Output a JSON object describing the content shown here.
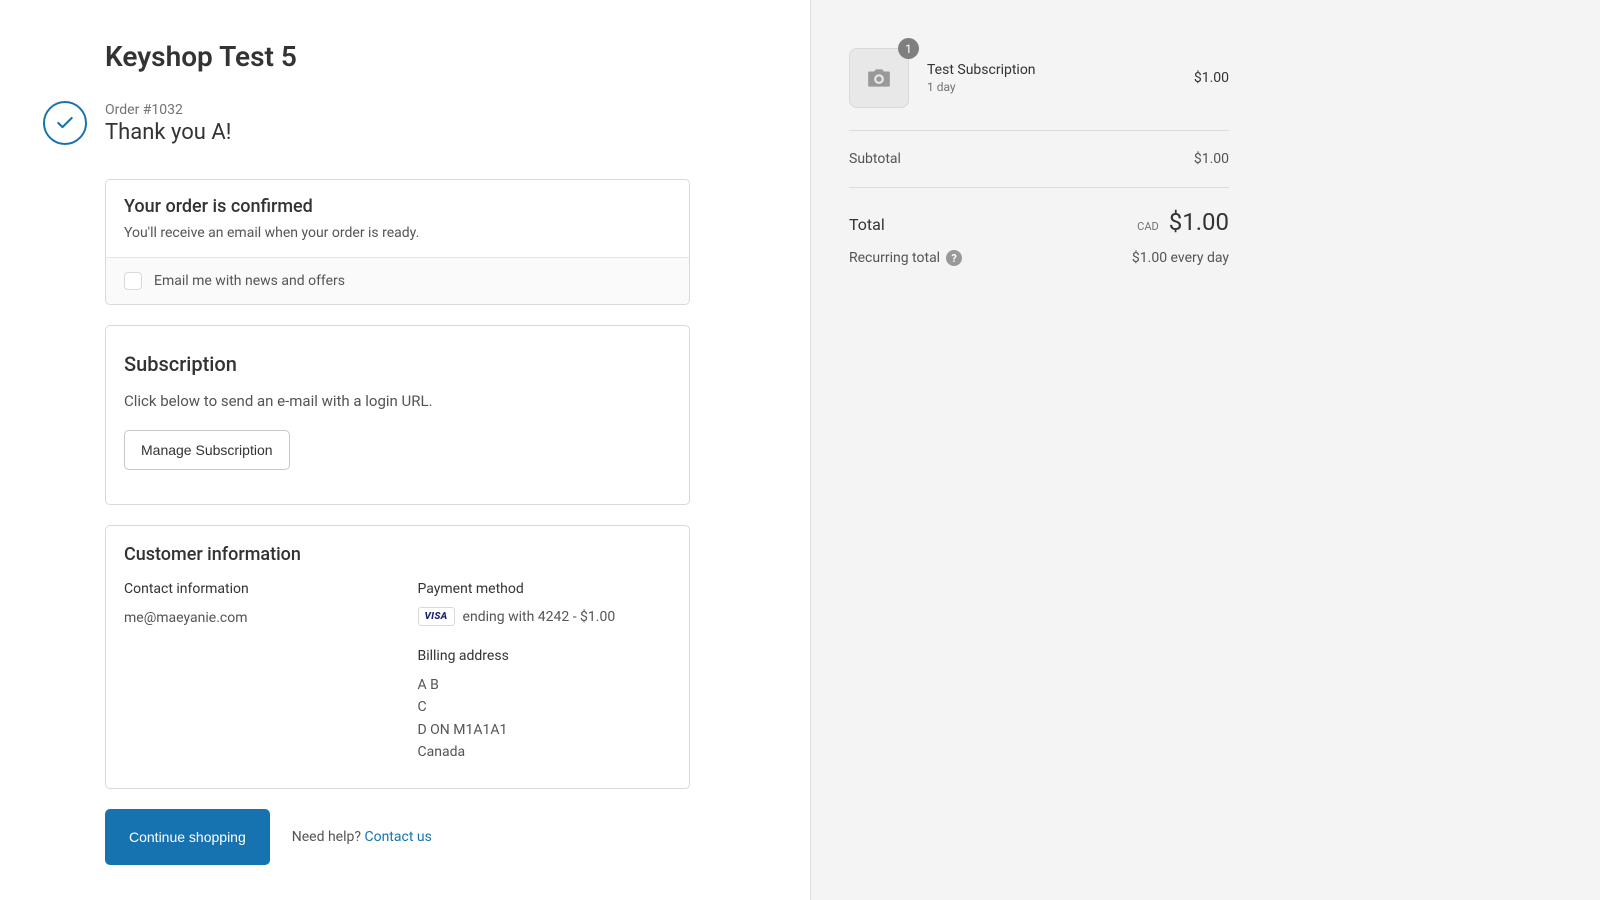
{
  "shop_title": "Keyshop Test 5",
  "order_number": "Order #1032",
  "thank_you": "Thank you A!",
  "confirmed": {
    "heading": "Your order is confirmed",
    "body": "You'll receive an email when your order is ready.",
    "newsletter_label": "Email me with news and offers"
  },
  "subscription": {
    "heading": "Subscription",
    "body": "Click below to send an e-mail with a login URL.",
    "button": "Manage Subscription"
  },
  "customer": {
    "heading": "Customer information",
    "contact_label": "Contact information",
    "contact_email": "me@maeyanie.com",
    "payment_label": "Payment method",
    "card_brand": "VISA",
    "card_text": "ending with 4242 - $1.00",
    "billing_label": "Billing address",
    "billing_line1": "A B",
    "billing_line2": "C",
    "billing_line3": "D ON M1A1A1",
    "billing_line4": "Canada"
  },
  "actions": {
    "continue": "Continue shopping",
    "help_prefix": "Need help? ",
    "contact": "Contact us"
  },
  "summary": {
    "item_qty": "1",
    "item_name": "Test Subscription",
    "item_meta": "1 day",
    "item_price": "$1.00",
    "subtotal_label": "Subtotal",
    "subtotal_value": "$1.00",
    "total_label": "Total",
    "currency": "CAD",
    "total_value": "$1.00",
    "recurring_label": "Recurring total",
    "recurring_value": "$1.00 every day"
  }
}
